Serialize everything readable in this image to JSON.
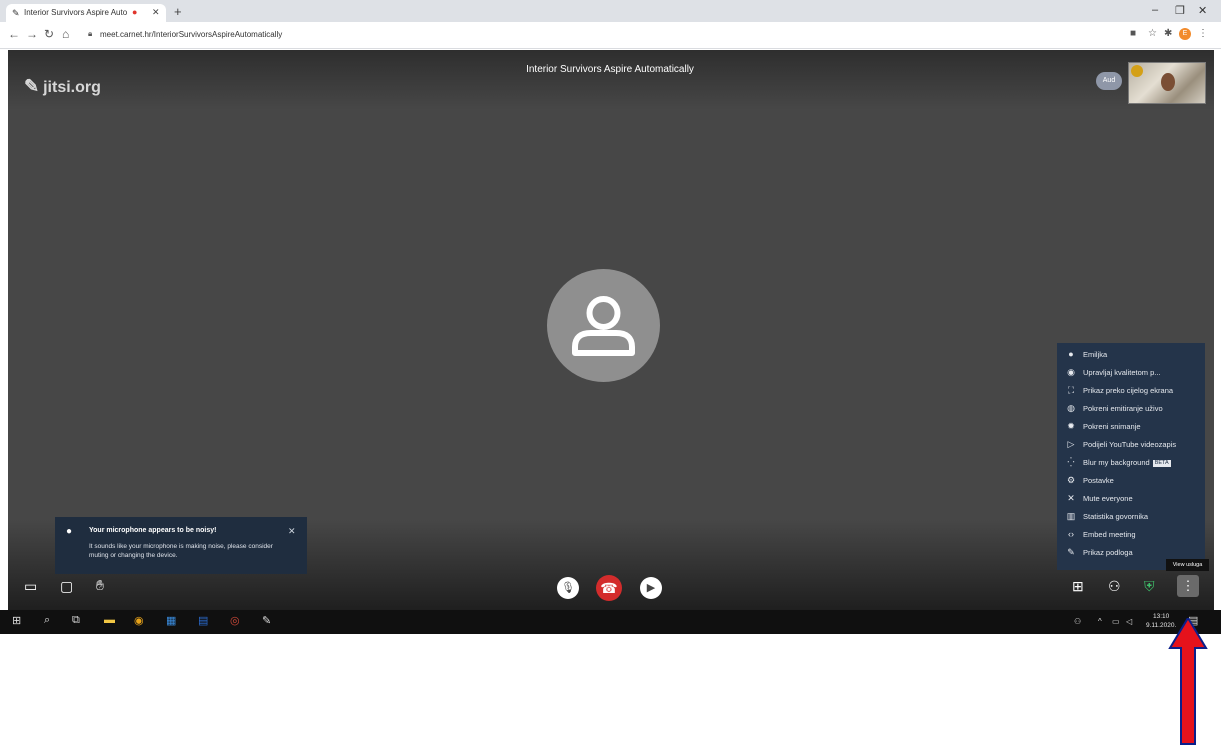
{
  "browser": {
    "tab_title": "Interior Survivors Aspire Auto",
    "new_tab_icon": "plus-icon",
    "url": "meet.carnet.hr/InteriorSurvivorsAspireAutomatically",
    "window_controls": {
      "minimize": "–",
      "maximize": "❐",
      "close": "✕"
    }
  },
  "meeting": {
    "logo_text": "jitsi.org",
    "title": "Interior Survivors Aspire Automatically",
    "participant_initials": "Aud"
  },
  "notification": {
    "title": "Your microphone appears to be noisy!",
    "body": "It sounds like your microphone is making noise, please consider muting or changing the device."
  },
  "menu": {
    "items": [
      {
        "icon": "avatar-icon",
        "label": "Emiljka"
      },
      {
        "icon": "hd-icon",
        "label": "Upravljaj kvalitetom p..."
      },
      {
        "icon": "fullscreen-icon",
        "label": "Prikaz preko cijelog ekrana"
      },
      {
        "icon": "globe-icon",
        "label": "Pokreni emitiranje uživo"
      },
      {
        "icon": "record-icon",
        "label": "Pokreni snimanje"
      },
      {
        "icon": "play-icon",
        "label": "Podijeli YouTube videozapis"
      },
      {
        "icon": "blur-icon",
        "label": "Blur my background",
        "badge": "BETA"
      },
      {
        "icon": "gear-icon",
        "label": "Postavke"
      },
      {
        "icon": "mute-all-icon",
        "label": "Mute everyone"
      },
      {
        "icon": "stats-icon",
        "label": "Statistika govornika"
      },
      {
        "icon": "code-icon",
        "label": "Embed meeting"
      },
      {
        "icon": "feedback-icon",
        "label": "Prikaz podloga"
      }
    ],
    "tooltip": "View usluga"
  },
  "taskbar": {
    "time": "13:10",
    "date": "9.11.2020."
  },
  "colors": {
    "stage": "#474747",
    "menu_bg": "#24344a",
    "hangup": "#d32c2c",
    "arrow": "#e5121c"
  }
}
